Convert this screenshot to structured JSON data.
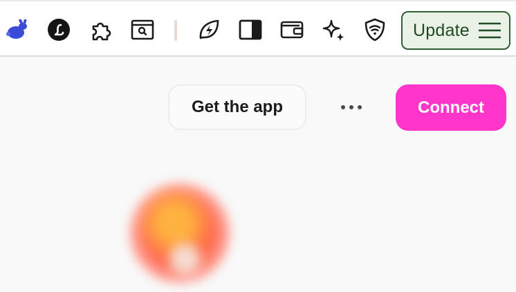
{
  "toolbar": {
    "extensions": [
      {
        "name": "rabbit-icon",
        "color": "#3b4bd8"
      },
      {
        "name": "l-logo-icon",
        "glyph": "L"
      },
      {
        "name": "puzzle-icon"
      },
      {
        "name": "browser-search-icon"
      },
      {
        "name": "leaf-bolt-icon"
      },
      {
        "name": "sidebar-icon"
      },
      {
        "name": "wallet-icon"
      },
      {
        "name": "sparkle-icon"
      },
      {
        "name": "shield-wifi-icon"
      }
    ],
    "update_button": {
      "label": "Update",
      "icon": "menu-icon",
      "border_color": "#2f5e34",
      "background": "#eaf2e6"
    }
  },
  "page": {
    "get_app_label": "Get the app",
    "more_icon": "more-horizontal-icon",
    "connect_label": "Connect",
    "connect_color": "#ff36c9",
    "avatar": "profile-avatar"
  }
}
